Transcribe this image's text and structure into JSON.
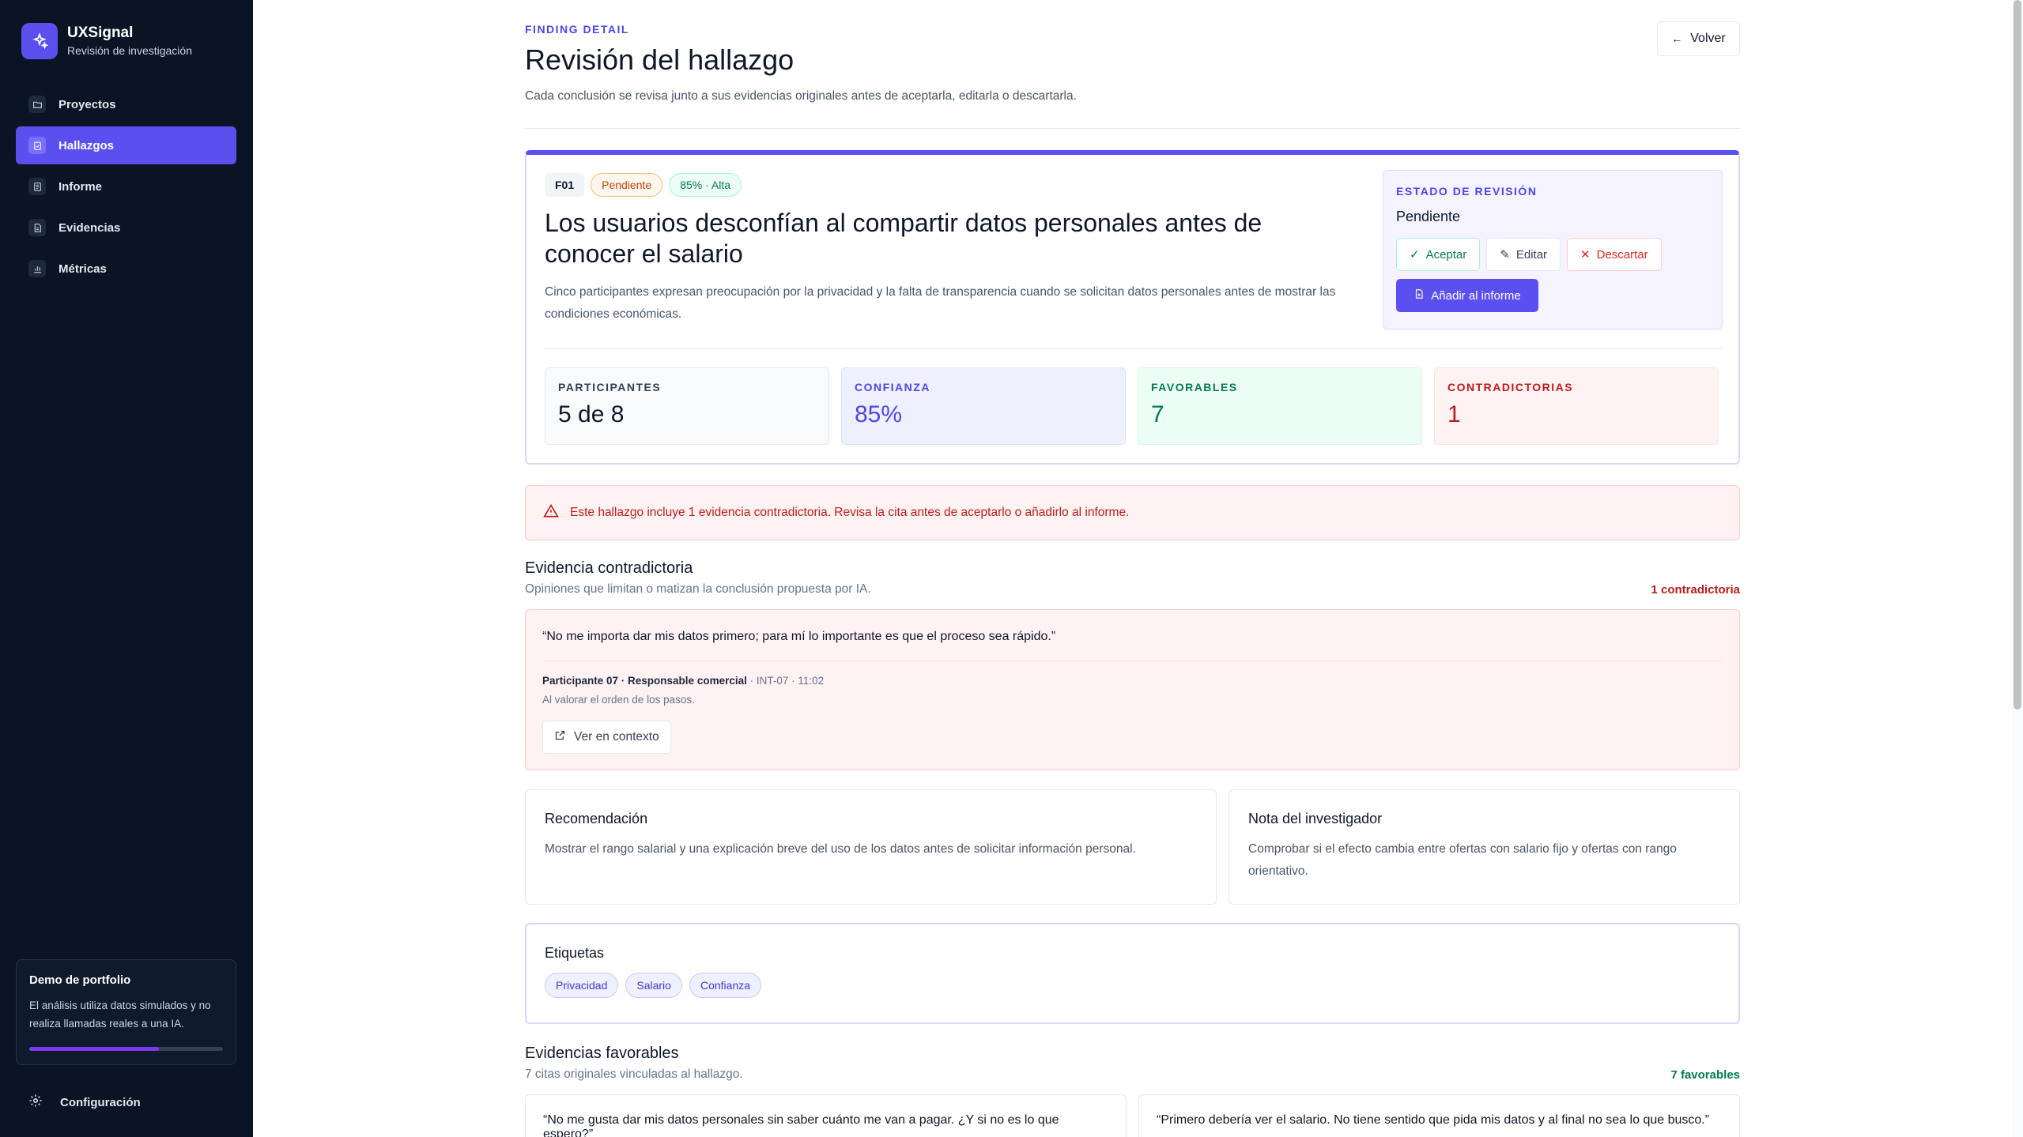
{
  "brand": {
    "name": "UXSignal",
    "subtitle": "Revisión de investigación"
  },
  "sidebar": {
    "items": [
      {
        "label": "Proyectos",
        "icon": "folder-icon",
        "active": false
      },
      {
        "label": "Hallazgos",
        "icon": "clipboard-check-icon",
        "active": true
      },
      {
        "label": "Informe",
        "icon": "report-icon",
        "active": false
      },
      {
        "label": "Evidencias",
        "icon": "document-icon",
        "active": false
      },
      {
        "label": "Métricas",
        "icon": "bar-chart-icon",
        "active": false
      }
    ],
    "demo": {
      "title": "Demo de portfolio",
      "text": "El análisis utiliza datos simulados y no realiza llamadas reales a una IA.",
      "progress": 0.67
    },
    "settings_label": "Configuración"
  },
  "header": {
    "eyebrow": "FINDING DETAIL",
    "title": "Revisión del hallazgo",
    "subtitle": "Cada conclusión se revisa junto a sus evidencias originales antes de aceptarla, editarla o descartarla.",
    "back_label": "Volver"
  },
  "finding": {
    "id": "F01",
    "status_badge": "Pendiente",
    "confidence_badge": "85% · Alta",
    "title": "Los usuarios desconfían al compartir datos personales antes de conocer el salario",
    "description": "Cinco participantes expresan preocupación por la privacidad y la falta de transparencia cuando se solicitan datos personales antes de mostrar las condiciones económicas.",
    "review": {
      "label": "ESTADO DE REVISIÓN",
      "status": "Pendiente",
      "accept_label": "Aceptar",
      "edit_label": "Editar",
      "discard_label": "Descartar",
      "add_label": "Añadir al informe"
    },
    "stats": [
      {
        "label": "PARTICIPANTES",
        "value": "5 de 8"
      },
      {
        "label": "CONFIANZA",
        "value": "85%"
      },
      {
        "label": "FAVORABLES",
        "value": "7"
      },
      {
        "label": "CONTRADICTORIAS",
        "value": "1"
      }
    ]
  },
  "alert": {
    "text": "Este hallazgo incluye 1 evidencia contradictoria. Revisa la cita antes de aceptarlo o añadirlo al informe."
  },
  "contradictory": {
    "title": "Evidencia contradictoria",
    "subtitle": "Opiniones que limitan o matizan la conclusión propuesta por IA.",
    "count": "1 contradictoria",
    "quote": "“No me importa dar mis datos primero; para mí lo importante es que el proceso sea rápido.”",
    "participant": "Participante 07 · Responsable comercial",
    "ref": " · INT-07 · 11:02",
    "context": "Al valorar el orden de los pasos.",
    "context_button": "Ver en contexto"
  },
  "recommendation": {
    "title": "Recomendación",
    "text": "Mostrar el rango salarial y una explicación breve del uso de los datos antes de solicitar información personal."
  },
  "researcher_note": {
    "title": "Nota del investigador",
    "text": "Comprobar si el efecto cambia entre ofertas con salario fijo y ofertas con rango orientativo."
  },
  "tags": {
    "title": "Etiquetas",
    "items": [
      "Privacidad",
      "Salario",
      "Confianza"
    ]
  },
  "favorable": {
    "title": "Evidencias favorables",
    "subtitle": "7 citas originales vinculadas al hallazgo.",
    "count": "7 favorables",
    "quotes": [
      "“No me gusta dar mis datos personales sin saber cuánto me van a pagar. ¿Y si no es lo que espero?”",
      "“Primero debería ver el salario. No tiene sentido que pida mis datos y al final no sea lo que busco.”"
    ]
  },
  "colors": {
    "accent": "#5b4ff0",
    "sidebar_bg": "#0b1424",
    "danger": "#b91c1c",
    "success": "#047857"
  }
}
